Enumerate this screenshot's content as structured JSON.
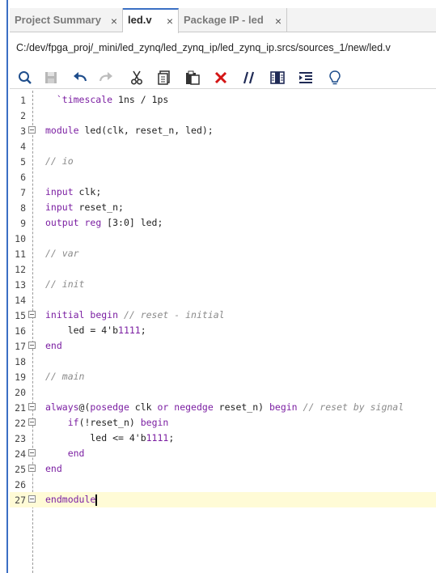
{
  "tabs": [
    {
      "label": "Project Summary",
      "close": "×",
      "active": false
    },
    {
      "label": "led.v",
      "close": "×",
      "active": true
    },
    {
      "label": "Package IP - led",
      "close": "×",
      "active": false
    }
  ],
  "file_path": "C:/dev/fpga_proj/_mini/led_zynq/led_zynq_ip/led_zynq_ip.srcs/sources_1/new/led.v",
  "toolbar": {
    "icons": [
      "search-icon",
      "save-icon",
      "undo-icon",
      "redo-icon",
      "cut-icon",
      "copy-icon",
      "paste-icon",
      "delete-icon",
      "comment-icon",
      "column-icon",
      "indent-icon",
      "bulb-icon"
    ]
  },
  "colors": {
    "keyword": "#7b1fa2",
    "comment": "#8a8a8a",
    "accent": "#3b6fc4",
    "current_line": "#fffbd6"
  },
  "editor": {
    "current_line": 27,
    "lines": [
      {
        "n": "1",
        "fold": false,
        "segs": [
          {
            "t": "  `timescale ",
            "k": "kw"
          },
          {
            "t": "1ns / 1ps",
            "k": ""
          }
        ]
      },
      {
        "n": "2",
        "fold": false,
        "segs": []
      },
      {
        "n": "3",
        "fold": true,
        "segs": [
          {
            "t": "module ",
            "k": "kw"
          },
          {
            "t": "led(clk, reset_n, led);",
            "k": ""
          }
        ]
      },
      {
        "n": "4",
        "fold": false,
        "segs": []
      },
      {
        "n": "5",
        "fold": false,
        "segs": [
          {
            "t": "// io",
            "k": "cm"
          }
        ]
      },
      {
        "n": "6",
        "fold": false,
        "segs": []
      },
      {
        "n": "7",
        "fold": false,
        "segs": [
          {
            "t": "input ",
            "k": "kw"
          },
          {
            "t": "clk;",
            "k": ""
          }
        ]
      },
      {
        "n": "8",
        "fold": false,
        "segs": [
          {
            "t": "input ",
            "k": "kw"
          },
          {
            "t": "reset_n;",
            "k": ""
          }
        ]
      },
      {
        "n": "9",
        "fold": false,
        "segs": [
          {
            "t": "output ",
            "k": "kw"
          },
          {
            "t": "reg ",
            "k": "kw"
          },
          {
            "t": "[3:0] led;",
            "k": ""
          }
        ]
      },
      {
        "n": "10",
        "fold": false,
        "segs": []
      },
      {
        "n": "11",
        "fold": false,
        "segs": [
          {
            "t": "// var",
            "k": "cm"
          }
        ]
      },
      {
        "n": "12",
        "fold": false,
        "segs": []
      },
      {
        "n": "13",
        "fold": false,
        "segs": [
          {
            "t": "// init",
            "k": "cm"
          }
        ]
      },
      {
        "n": "14",
        "fold": false,
        "segs": []
      },
      {
        "n": "15",
        "fold": true,
        "segs": [
          {
            "t": "initial ",
            "k": "kw"
          },
          {
            "t": "begin ",
            "k": "kw"
          },
          {
            "t": "// reset - initial",
            "k": "cm"
          }
        ]
      },
      {
        "n": "16",
        "fold": false,
        "segs": [
          {
            "t": "    led = 4'b",
            "k": ""
          },
          {
            "t": "1111",
            "k": "num"
          },
          {
            "t": ";",
            "k": ""
          }
        ]
      },
      {
        "n": "17",
        "fold": true,
        "segs": [
          {
            "t": "end",
            "k": "kw"
          }
        ]
      },
      {
        "n": "18",
        "fold": false,
        "segs": []
      },
      {
        "n": "19",
        "fold": false,
        "segs": [
          {
            "t": "// main",
            "k": "cm"
          }
        ]
      },
      {
        "n": "20",
        "fold": false,
        "segs": []
      },
      {
        "n": "21",
        "fold": true,
        "segs": [
          {
            "t": "always",
            "k": "kw"
          },
          {
            "t": "@(",
            "k": ""
          },
          {
            "t": "posedge ",
            "k": "kw"
          },
          {
            "t": "clk ",
            "k": ""
          },
          {
            "t": "or ",
            "k": "kw"
          },
          {
            "t": "negedge ",
            "k": "kw"
          },
          {
            "t": "reset_n) ",
            "k": ""
          },
          {
            "t": "begin ",
            "k": "kw"
          },
          {
            "t": "// reset by signal",
            "k": "cm"
          }
        ]
      },
      {
        "n": "22",
        "fold": true,
        "segs": [
          {
            "t": "    ",
            "k": ""
          },
          {
            "t": "if",
            "k": "kw"
          },
          {
            "t": "(!reset_n) ",
            "k": ""
          },
          {
            "t": "begin",
            "k": "kw"
          }
        ]
      },
      {
        "n": "23",
        "fold": false,
        "segs": [
          {
            "t": "        led <= 4'b",
            "k": ""
          },
          {
            "t": "1111",
            "k": "num"
          },
          {
            "t": ";",
            "k": ""
          }
        ]
      },
      {
        "n": "24",
        "fold": true,
        "segs": [
          {
            "t": "    ",
            "k": ""
          },
          {
            "t": "end",
            "k": "kw"
          }
        ]
      },
      {
        "n": "25",
        "fold": true,
        "segs": [
          {
            "t": "end",
            "k": "kw"
          }
        ]
      },
      {
        "n": "26",
        "fold": false,
        "segs": []
      },
      {
        "n": "27",
        "fold": true,
        "segs": [
          {
            "t": "endmodule",
            "k": "kw"
          }
        ]
      }
    ]
  }
}
